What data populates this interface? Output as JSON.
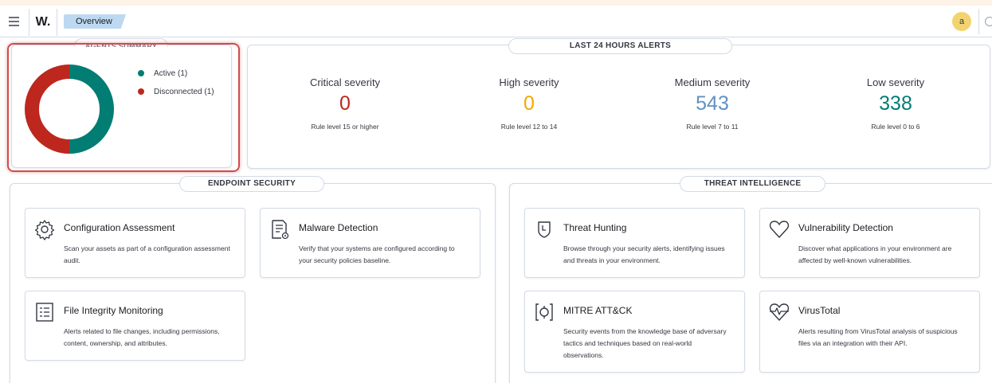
{
  "header": {
    "logo": "W.",
    "breadcrumb": "Overview",
    "user_initial": "a"
  },
  "agents_summary": {
    "title": "AGENTS SUMMARY",
    "legend": [
      {
        "label": "Active (1)",
        "color": "#017d73"
      },
      {
        "label": "Disconnected (1)",
        "color": "#bd271e"
      }
    ],
    "chart_data": {
      "type": "pie",
      "categories": [
        "Active",
        "Disconnected"
      ],
      "values": [
        1,
        1
      ],
      "colors": [
        "#017d73",
        "#bd271e"
      ]
    }
  },
  "alerts": {
    "title": "LAST 24 HOURS ALERTS",
    "items": [
      {
        "label": "Critical severity",
        "value": "0",
        "sub": "Rule level 15 or higher",
        "color": "#bd271e"
      },
      {
        "label": "High severity",
        "value": "0",
        "sub": "Rule level 12 to 14",
        "color": "#f5a700"
      },
      {
        "label": "Medium severity",
        "value": "543",
        "sub": "Rule level 7 to 11",
        "color": "#6092c0"
      },
      {
        "label": "Low severity",
        "value": "338",
        "sub": "Rule level 0 to 6",
        "color": "#017d73"
      }
    ]
  },
  "endpoint_security": {
    "title": "ENDPOINT SECURITY",
    "cards": [
      {
        "title": "Configuration Assessment",
        "desc": "Scan your assets as part of a configuration assessment audit."
      },
      {
        "title": "Malware Detection",
        "desc": "Verify that your systems are configured according to your security policies baseline."
      },
      {
        "title": "File Integrity Monitoring",
        "desc": "Alerts related to file changes, including permissions, content, ownership, and attributes."
      }
    ]
  },
  "threat_intelligence": {
    "title": "THREAT INTELLIGENCE",
    "cards": [
      {
        "title": "Threat Hunting",
        "desc": "Browse through your security alerts, identifying issues and threats in your environment."
      },
      {
        "title": "Vulnerability Detection",
        "desc": "Discover what applications in your environment are affected by well-known vulnerabilities."
      },
      {
        "title": "MITRE ATT&CK",
        "desc": "Security events from the knowledge base of adversary tactics and techniques based on real-world observations."
      },
      {
        "title": "VirusTotal",
        "desc": "Alerts resulting from VirusTotal analysis of suspicious files via an integration with their API."
      }
    ]
  }
}
